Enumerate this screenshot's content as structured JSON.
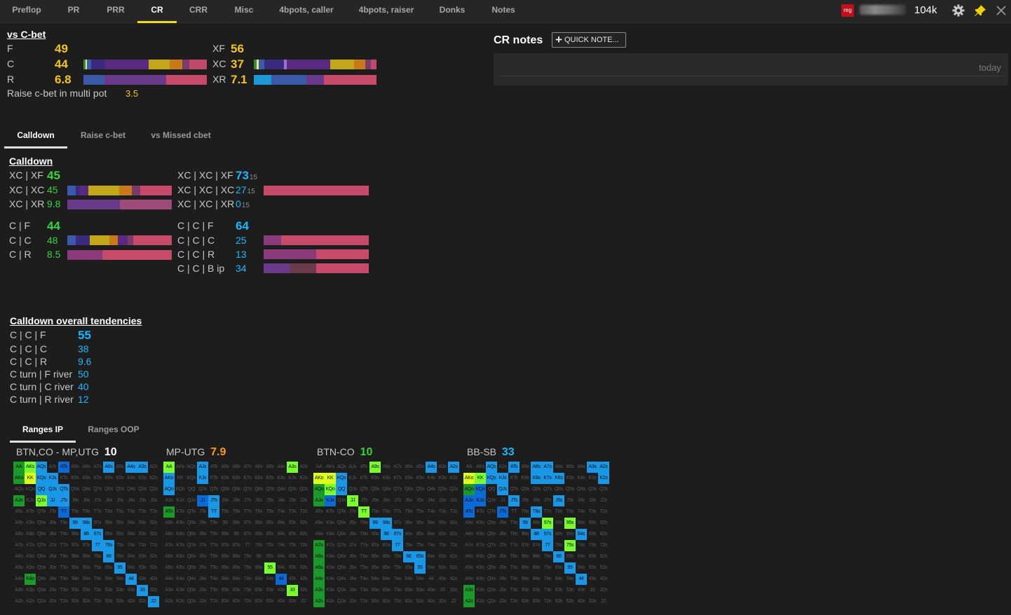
{
  "tabs": [
    "Preflop",
    "PR",
    "PRR",
    "CR",
    "CRR",
    "Misc",
    "4bpots, caller",
    "4bpots, raiser",
    "Donks",
    "Notes"
  ],
  "active_tab": "CR",
  "top_right": {
    "badge": "reg",
    "player_name_blurred": true,
    "stack": "104k",
    "icons": [
      "gear-icon",
      "pin-icon",
      "close-icon"
    ]
  },
  "colors": {
    "yellow": "#f5c518",
    "green": "#36d43a",
    "blue": "#1ab8ff",
    "orange": "#ff9a1e",
    "accent": "#f2e000"
  },
  "vs_cbet": {
    "title": "vs C-bet",
    "left": [
      {
        "label": "F",
        "value": "49",
        "bar": null
      },
      {
        "label": "C",
        "value": "44",
        "bar": "spectrum"
      },
      {
        "label": "R",
        "value": "6.8",
        "bar": "raise"
      }
    ],
    "right": [
      {
        "label": "XF",
        "value": "56",
        "bar": null
      },
      {
        "label": "XC",
        "value": "37",
        "bar": "spectrum2"
      },
      {
        "label": "XR",
        "value": "7.1",
        "bar": "raise2"
      }
    ],
    "multi": {
      "label": "Raise c-bet in multi pot",
      "value": "3.5"
    }
  },
  "notes": {
    "title": "CR notes",
    "button": "QUICK NOTE...",
    "date": "today"
  },
  "sub_tabs": [
    "Calldown",
    "Raise c-bet",
    "vs Missed cbet"
  ],
  "calldown": {
    "title": "Calldown",
    "left1": [
      {
        "label": "XC | XF",
        "value": "45"
      },
      {
        "label": "XC | XC",
        "value": "45"
      },
      {
        "label": "XC | XR",
        "value": "9.8"
      }
    ],
    "left2": [
      {
        "label": "C | F",
        "value": "44"
      },
      {
        "label": "C | C",
        "value": "48"
      },
      {
        "label": "C | R",
        "value": "8.5"
      }
    ],
    "right1": [
      {
        "label": "XC | XC | XF",
        "value": "73",
        "sub": "15"
      },
      {
        "label": "XC | XC | XC",
        "value": "27",
        "sub": "15"
      },
      {
        "label": "XC | XC | XR",
        "value": "0",
        "sub": "15"
      }
    ],
    "right2": [
      {
        "label": "C | C | F",
        "value": "64"
      },
      {
        "label": "C | C | C",
        "value": "25"
      },
      {
        "label": "C | C | R",
        "value": "13"
      },
      {
        "label": "C | C | B ip",
        "value": "34"
      }
    ]
  },
  "tendencies": {
    "title": "Calldown overall tendencies",
    "rows": [
      {
        "label": "C | C | F",
        "value": "55"
      },
      {
        "label": "C | C | C",
        "value": "38"
      },
      {
        "label": "C | C | R",
        "value": "9.6"
      },
      {
        "label": "C turn | F river",
        "value": "50"
      },
      {
        "label": "C turn | C river",
        "value": "40"
      },
      {
        "label": "C turn | R river",
        "value": "12"
      }
    ]
  },
  "range_tabs": [
    "Ranges IP",
    "Ranges OOP"
  ],
  "ranges": [
    {
      "title": "BTN,CO - MP,UTG",
      "value": "10"
    },
    {
      "title": "MP-UTG",
      "value": "7.9"
    },
    {
      "title": "BTN-CO",
      "value": "10"
    },
    {
      "title": "BB-SB",
      "value": "33"
    }
  ]
}
